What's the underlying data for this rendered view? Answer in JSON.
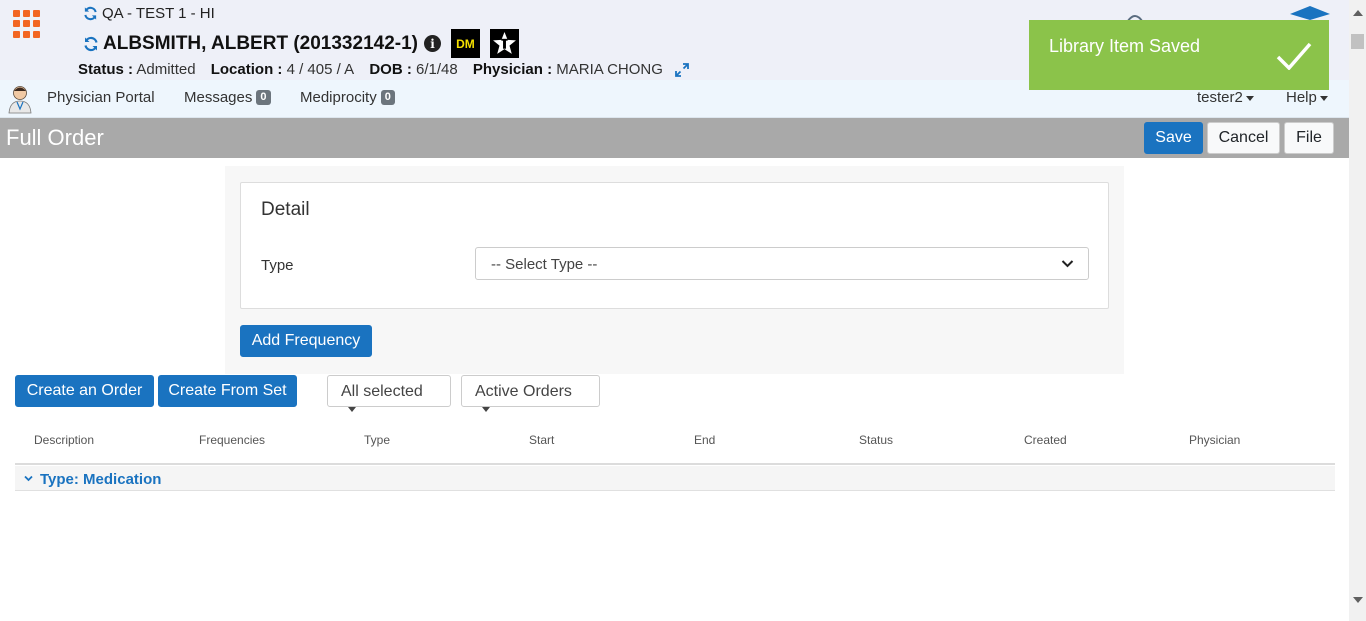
{
  "header": {
    "facility": "QA - TEST 1 - HI",
    "patient_name": "ALBSMITH, ALBERT (201332142-1)",
    "badge_dm": "DM",
    "status_label": "Status :",
    "status_value": "Admitted",
    "location_label": "Location :",
    "location_value": "4 / 405 / A",
    "dob_label": "DOB :",
    "dob_value": "6/1/48",
    "physician_label": "Physician :",
    "physician_value": "MARIA CHONG"
  },
  "toast": {
    "message": "Library Item Saved",
    "color": "#8bc34a"
  },
  "nav": {
    "items": [
      {
        "label": "Physician Portal"
      },
      {
        "label": "Messages",
        "count": "0"
      },
      {
        "label": "Mediprocity",
        "count": "0"
      }
    ],
    "user": "tester2",
    "help": "Help"
  },
  "titlebar": {
    "title": "Full Order",
    "save": "Save",
    "cancel": "Cancel",
    "file": "File"
  },
  "detail": {
    "title": "Detail",
    "type_label": "Type",
    "type_select": "-- Select Type --",
    "add_frequency": "Add Frequency"
  },
  "toolbar": {
    "create_order": "Create an Order",
    "create_from_set": "Create From Set",
    "filter_all": "All selected",
    "filter_active": "Active Orders"
  },
  "table": {
    "columns": [
      "Description",
      "Frequencies",
      "Type",
      "Start",
      "End",
      "Status",
      "Created",
      "Physician"
    ],
    "group": "Type: Medication"
  },
  "colors": {
    "primary": "#1a73c0",
    "accent": "#f26522"
  }
}
